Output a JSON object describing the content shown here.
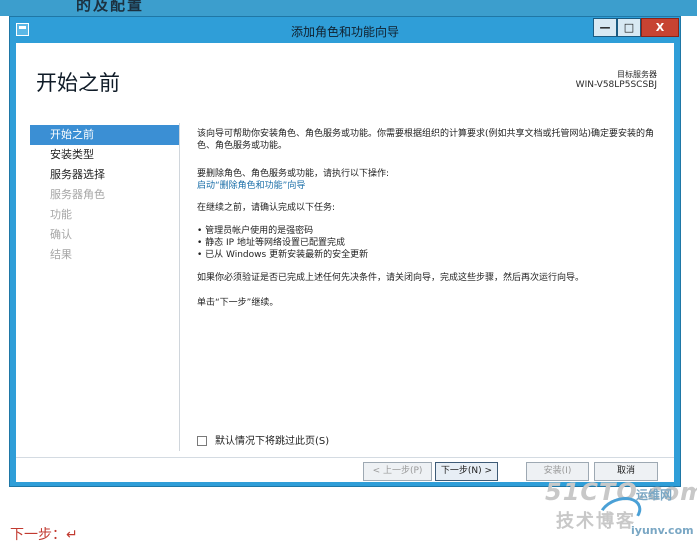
{
  "window": {
    "title": "添加角色和功能向导",
    "min_label": "—",
    "max_label": "□",
    "close_label": "X"
  },
  "page": {
    "heading": "开始之前",
    "server_label": "目标服务器",
    "server_name": "WIN-V58LP5SCSBJ"
  },
  "nav": {
    "items": [
      {
        "label": "开始之前",
        "state": "active"
      },
      {
        "label": "安装类型",
        "state": "enabled"
      },
      {
        "label": "服务器选择",
        "state": "enabled"
      },
      {
        "label": "服务器角色",
        "state": "disabled"
      },
      {
        "label": "功能",
        "state": "disabled"
      },
      {
        "label": "确认",
        "state": "disabled"
      },
      {
        "label": "结果",
        "state": "disabled"
      }
    ]
  },
  "content": {
    "intro": "该向导可帮助你安装角色、角色服务或功能。你需要根据组织的计算要求(例如共享文档或托管网站)确定要安装的角色、角色服务或功能。",
    "remove_prompt": "要删除角色、角色服务或功能，请执行以下操作:",
    "remove_link": "启动“删除角色和功能”向导",
    "before_continue": "在继续之前，请确认完成以下任务:",
    "tasks": [
      "• 管理员帐户使用的是强密码",
      "• 静态 IP 地址等网络设置已配置完成",
      "• 已从 Windows 更新安装最新的安全更新"
    ],
    "verify": "如果你必须验证是否已完成上述任何先决条件，请关闭向导，完成这些步骤，然后再次运行向导。",
    "click_next": "单击“下一步”继续。",
    "skip_label": "默认情况下将跳过此页(S)"
  },
  "footer": {
    "prev_label": "< 上一步(P)",
    "next_label": "下一步(N) >",
    "install_label": "安装(I)",
    "cancel_label": "取消"
  },
  "document": {
    "top_clip": "的及配置",
    "caption": "下一步：↵"
  },
  "watermark": {
    "line1": "51CTO.com",
    "line2": "技术博客",
    "line3": "运维网",
    "line4": "iyunv.com"
  },
  "colors": {
    "titlebar": "#2f9ed8",
    "nav_active": "#3b8fd4",
    "link": "#1a6ea8",
    "close_button": "#c74332"
  }
}
